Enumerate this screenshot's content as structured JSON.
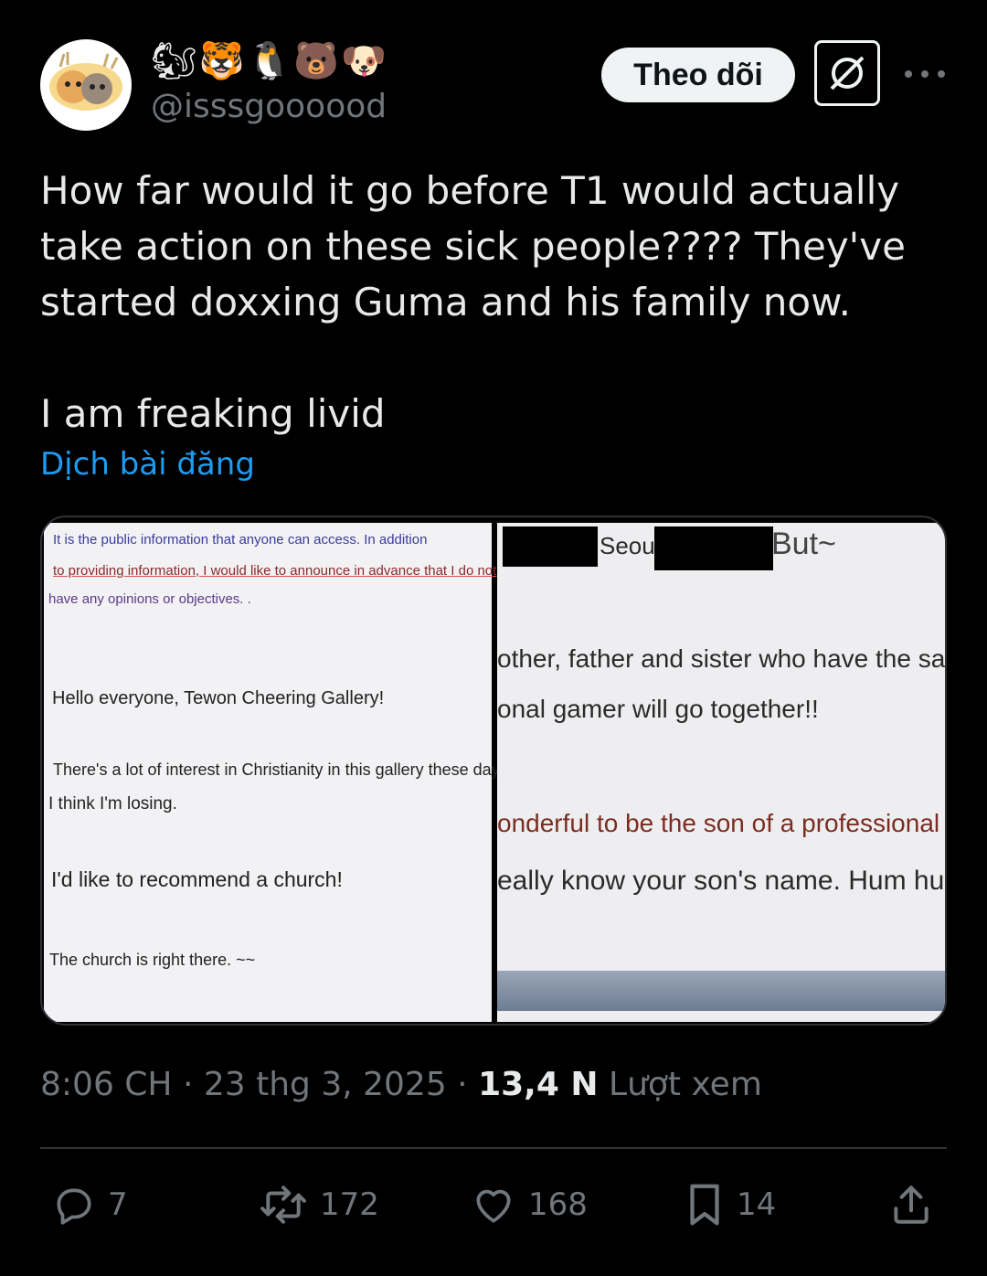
{
  "header": {
    "emojis": "🐿🐯🐧🐻🐶",
    "handle": "@isssgoooood",
    "follow_label": "Theo dõi"
  },
  "tweet": {
    "text": "How far would it go before T1 would actually take action on these sick people???? They've started doxxing Guma and his family now.\n\nI am freaking livid",
    "translate_label": "Dịch bài đăng"
  },
  "media_left": {
    "line1": "It is the public information that anyone can access. In addition",
    "line2": "to providing information, I would like to announce in advance that I do not",
    "line3": "have any opinions or objectives. .",
    "greeting": "Hello everyone, Tewon Cheering Gallery!",
    "interest": "There's a lot of interest in Christianity in this gallery these days.",
    "losing": "I think I'm losing.",
    "recommend": "I'd like to recommend a church!",
    "church": "The church is right there. ~~"
  },
  "media_right": {
    "seoul": "Seoul",
    "but": "But~",
    "line1": "other, father and sister who have the sa",
    "line2": "onal gamer will go together!!",
    "line3": "onderful to be the son of a professional gam",
    "line4": "eally know your son's name. Hum hum T"
  },
  "meta": {
    "time": "8:06 CH",
    "date": "23 thg 3, 2025",
    "views": "13,4 N",
    "views_label": "Lượt xem"
  },
  "actions": {
    "replies": "7",
    "reposts": "172",
    "likes": "168",
    "bookmarks": "14"
  }
}
